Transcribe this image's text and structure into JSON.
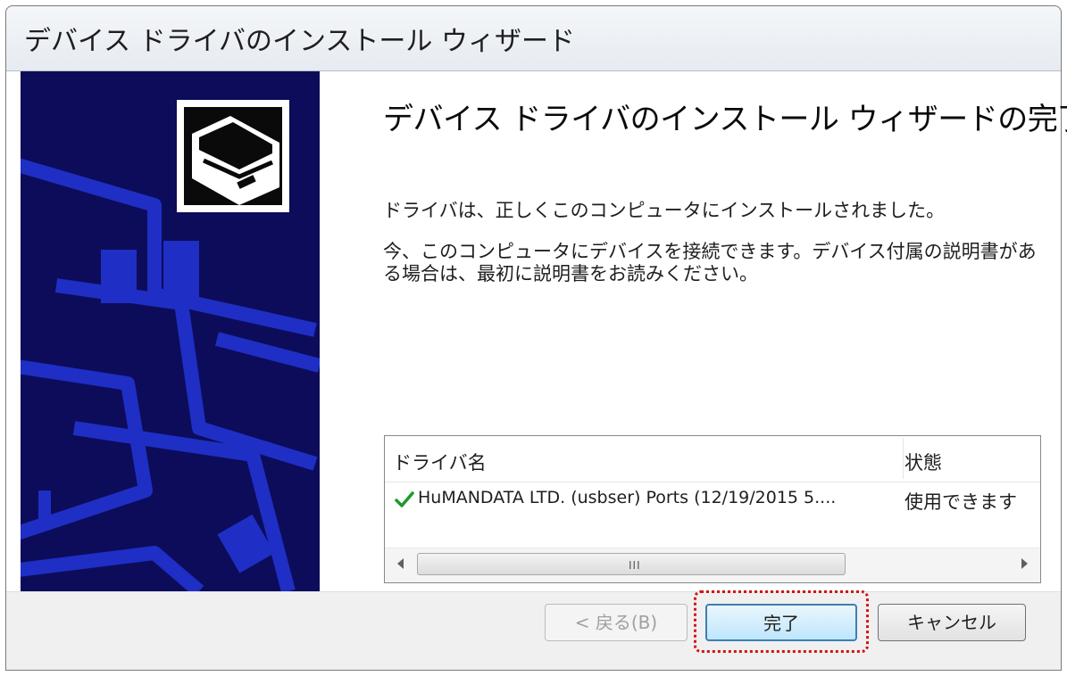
{
  "window": {
    "title": "デバイス ドライバのインストール ウィザード"
  },
  "main": {
    "heading": "デバイス ドライバのインストール ウィザードの完了",
    "message_installed": "ドライバは、正しくこのコンピュータにインストールされました。",
    "message_connect": "今、このコンピュータにデバイスを接続できます。デバイス付属の説明書がある場合は、最初に説明書をお読みください。"
  },
  "driver_list": {
    "columns": [
      "ドライバ名",
      "状態"
    ],
    "rows": [
      {
        "name": "HuMANDATA LTD. (usbser) Ports  (12/19/2015 5....",
        "status": "使用できます",
        "icon": "check-icon"
      }
    ],
    "scrollbar_grip": "III"
  },
  "buttons": {
    "back": "< 戻る(B)",
    "finish": "完了",
    "cancel": "キャンセル"
  },
  "colors": {
    "banner": "#0c0c5a",
    "banner_lines": "#1f2ec4",
    "check": "#1d9a2c",
    "highlight": "#d21414"
  }
}
